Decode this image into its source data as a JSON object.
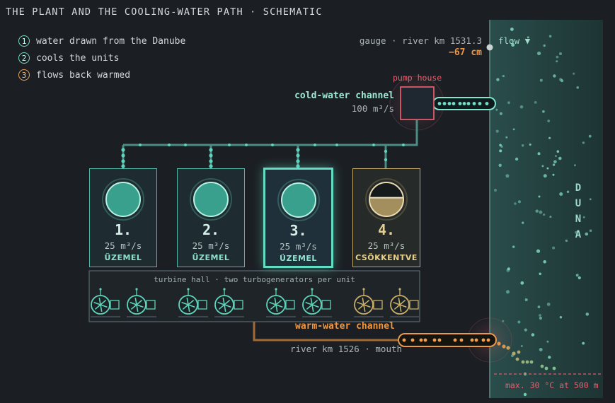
{
  "title": "THE PLANT AND THE COOLING-WATER PATH · SCHEMATIC",
  "legend": [
    {
      "num": "1",
      "text": "water drawn from the Danube",
      "kind": "cold"
    },
    {
      "num": "2",
      "text": "cools the units",
      "kind": "cold"
    },
    {
      "num": "3",
      "text": "flows back warmed",
      "kind": "warm"
    }
  ],
  "gauge": {
    "label": "gauge · river km 1531.3",
    "level": "−67 cm",
    "flow_label": "flow ▼"
  },
  "pump_house": {
    "label": "pump house"
  },
  "cold_channel": {
    "label": "cold-water channel",
    "rate": "100 m³/s"
  },
  "units": [
    {
      "number": "1.",
      "flow": "25 m³/s",
      "status": "ÜZEMEL",
      "state": "running",
      "fill": 1.0
    },
    {
      "number": "2.",
      "flow": "25 m³/s",
      "status": "ÜZEMEL",
      "state": "running",
      "fill": 1.0
    },
    {
      "number": "3.",
      "flow": "25 m³/s",
      "status": "ÜZEMEL",
      "state": "active",
      "fill": 1.0
    },
    {
      "number": "4.",
      "flow": "25 m³/s",
      "status": "CSÖKKENTVE",
      "state": "reduced",
      "fill": 0.55
    }
  ],
  "turbine_hall": {
    "label": "turbine hall · two turbogenerators per unit"
  },
  "warm_channel": {
    "label": "warm-water channel",
    "mouth": "river km 1526 · mouth"
  },
  "river": {
    "name": "DUNA",
    "limit": "max. 30 °C at 500 m"
  },
  "colors": {
    "cold": "#5fd3bb",
    "warm": "#e89a48",
    "reduced": "#c9ad68",
    "alert": "#e05a6a",
    "river": "#1f3b3c"
  }
}
